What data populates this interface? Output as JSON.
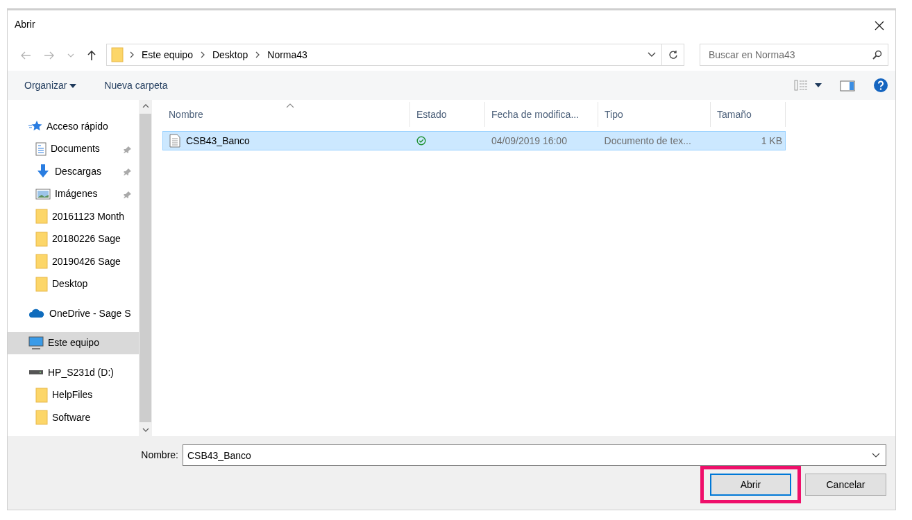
{
  "window": {
    "title": "Abrir"
  },
  "address": {
    "path": [
      "Este equipo",
      "Desktop",
      "Norma43"
    ]
  },
  "search": {
    "placeholder": "Buscar en Norma43"
  },
  "toolbar": {
    "organize": "Organizar",
    "new_folder": "Nueva carpeta"
  },
  "sidebar": {
    "items": [
      {
        "label": "Acceso rápido",
        "kind": "quick",
        "selected": false,
        "children": [
          {
            "label": "Documents",
            "kind": "documents",
            "pinned": true,
            "selected": false
          },
          {
            "label": "Descargas",
            "kind": "downloads",
            "pinned": true,
            "selected": false
          },
          {
            "label": "Imágenes",
            "kind": "pictures",
            "pinned": true,
            "selected": false
          },
          {
            "label": "20161123 Month",
            "kind": "folder",
            "pinned": false,
            "selected": false
          },
          {
            "label": "20180226 Sage",
            "kind": "folder",
            "pinned": false,
            "selected": false
          },
          {
            "label": "20190426 Sage",
            "kind": "folder",
            "pinned": false,
            "selected": false
          },
          {
            "label": "Desktop",
            "kind": "folder",
            "pinned": false,
            "selected": false
          }
        ]
      },
      {
        "label": "OneDrive - Sage S",
        "kind": "cloud",
        "selected": false
      },
      {
        "label": "Este equipo",
        "kind": "pc",
        "selected": true
      },
      {
        "label": "HP_S231d (D:)",
        "kind": "drive",
        "selected": false,
        "children": [
          {
            "label": "HelpFiles",
            "kind": "folder",
            "pinned": false,
            "selected": false
          },
          {
            "label": "Software",
            "kind": "folder",
            "pinned": false,
            "selected": false
          }
        ]
      }
    ]
  },
  "table": {
    "columns": [
      {
        "label": "Nombre",
        "sorted": true
      },
      {
        "label": "Estado",
        "sorted": false
      },
      {
        "label": "Fecha de modifica...",
        "sorted": false
      },
      {
        "label": "Tipo",
        "sorted": false
      },
      {
        "label": "Tamaño",
        "sorted": false
      }
    ],
    "rows": [
      {
        "name": "CSB43_Banco",
        "synced": true,
        "date": "04/09/2019 16:00",
        "type": "Documento de tex...",
        "size": "1 KB",
        "selected": true
      }
    ]
  },
  "footer": {
    "name_label": "Nombre:",
    "name_value": "CSB43_Banco",
    "buttons": [
      {
        "label": "Abrir",
        "default": true,
        "highlighted": true
      },
      {
        "label": "Cancelar",
        "default": false,
        "highlighted": false
      }
    ]
  }
}
